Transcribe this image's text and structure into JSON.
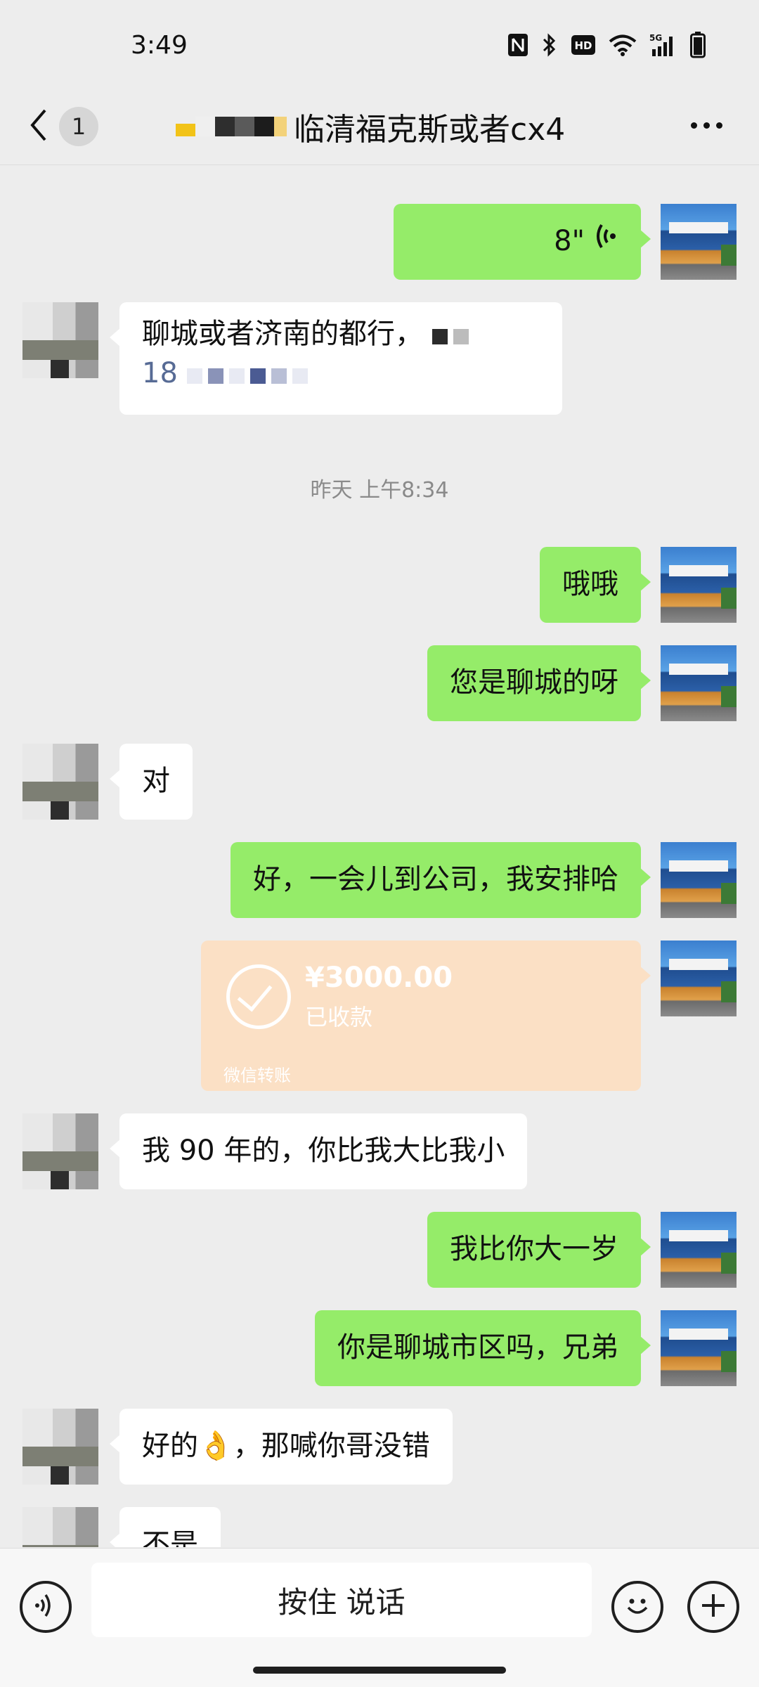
{
  "status_bar": {
    "time": "3:49",
    "icons": [
      "nfc-icon",
      "bluetooth-icon",
      "hd-icon",
      "wifi-icon",
      "5g-signal-icon",
      "battery-icon"
    ],
    "hd_label": "HD",
    "network_label": "5G"
  },
  "nav": {
    "back_icon": "chevron-left-icon",
    "unread_count": "1",
    "title": "临清福克斯或者cx4",
    "more_icon": "more-icon"
  },
  "messages": [
    {
      "sender": "self",
      "type": "voice",
      "duration": "8\""
    },
    {
      "sender": "other",
      "type": "text",
      "line1": "聊城或者济南的都行，",
      "phone_prefix": "18"
    },
    {
      "type": "timestamp",
      "text": "昨天 上午8:34"
    },
    {
      "sender": "self",
      "type": "text",
      "text": "哦哦"
    },
    {
      "sender": "self",
      "type": "text",
      "text": "您是聊城的呀"
    },
    {
      "sender": "other",
      "type": "text",
      "text": "对"
    },
    {
      "sender": "self",
      "type": "text",
      "text": "好，一会儿到公司，我安排哈"
    },
    {
      "sender": "self",
      "type": "transfer",
      "amount": "¥3000.00",
      "status": "已收款",
      "footer": "微信转账"
    },
    {
      "sender": "other",
      "type": "text",
      "text": "我 90 年的，你比我大比我小"
    },
    {
      "sender": "self",
      "type": "text",
      "text": "我比你大一岁"
    },
    {
      "sender": "self",
      "type": "text",
      "text": "你是聊城市区吗，兄弟"
    },
    {
      "sender": "other",
      "type": "text",
      "text": "好的👌，那喊你哥没错"
    },
    {
      "sender": "other",
      "type": "text",
      "text": "不是"
    }
  ],
  "input_bar": {
    "voice_icon": "voice-input-icon",
    "hold_to_talk": "按住 说话",
    "emoji_icon": "emoji-icon",
    "plus_icon": "plus-icon"
  },
  "colors": {
    "background": "#ededed",
    "self_bubble": "#95ec69",
    "other_bubble": "#ffffff",
    "transfer_card": "#fbe0c5",
    "link_blue": "#576b95"
  }
}
